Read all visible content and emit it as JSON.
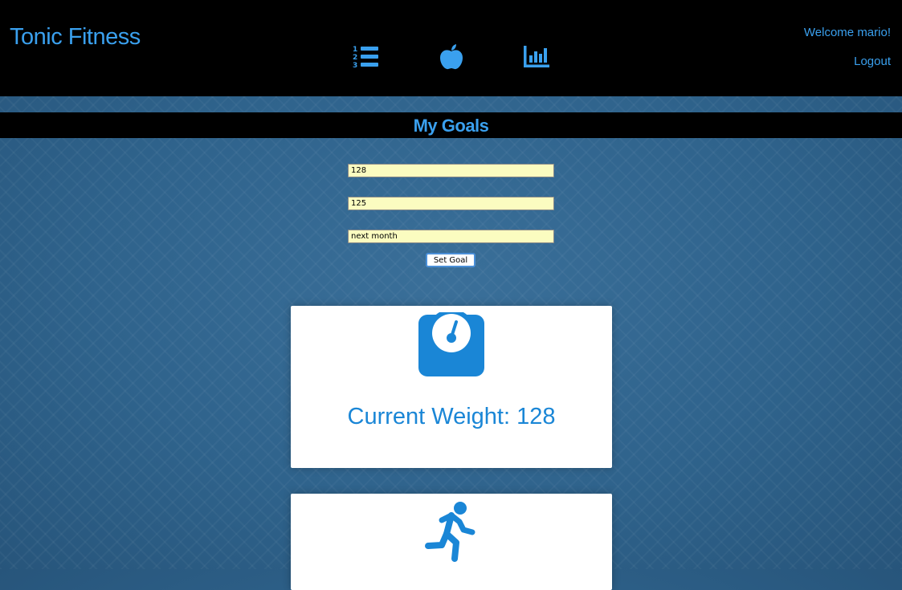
{
  "header": {
    "brand": "Tonic Fitness",
    "nav": [
      {
        "icon": "list-numbered-icon"
      },
      {
        "icon": "apple-icon"
      },
      {
        "icon": "bar-chart-icon"
      }
    ],
    "welcome": "Welcome mario!",
    "logout": "Logout"
  },
  "page": {
    "title": "My Goals"
  },
  "form": {
    "current_weight_value": "128",
    "goal_weight_value": "125",
    "deadline_value": "next month",
    "submit_label": "Set Goal"
  },
  "cards": [
    {
      "icon": "scale-icon",
      "label": "Current Weight: 128"
    },
    {
      "icon": "running-person-icon"
    }
  ],
  "colors": {
    "accent": "#3aa0ee",
    "card_blue": "#1a86d6",
    "input_bg": "#fbfcc0",
    "header_bg": "#000000"
  }
}
